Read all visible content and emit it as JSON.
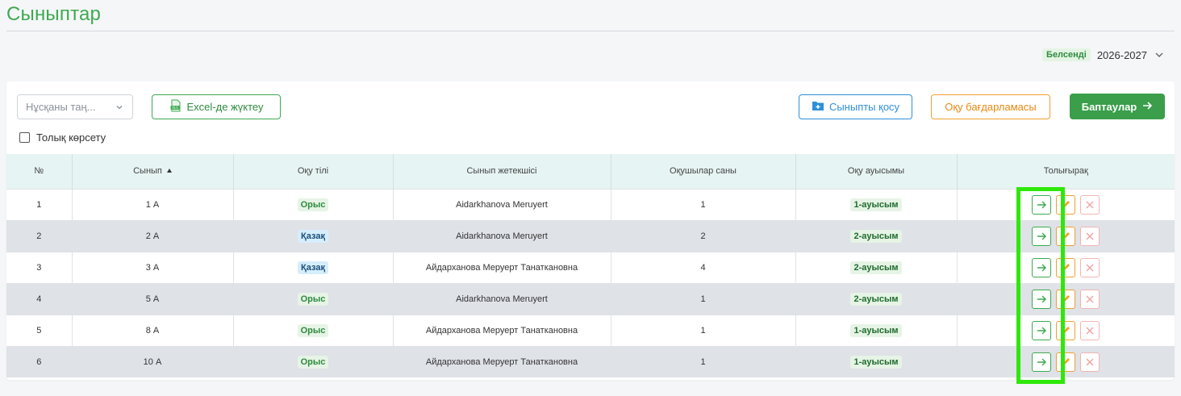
{
  "page": {
    "title": "Сыныптар"
  },
  "year_selector": {
    "badge": "Белсенді",
    "value": "2026-2027"
  },
  "toolbar": {
    "select_placeholder": "Нұсқаны таң...",
    "excel_label": "Excel-де жүктеу",
    "add_class_label": "Сыныпты қосу",
    "program_label": "Оқу бағдарламасы",
    "settings_label": "Баптаулар",
    "full_view_label": "Толық көрсету"
  },
  "table": {
    "headers": {
      "num": "№",
      "class": "Сынып",
      "language": "Оқу тілі",
      "teacher": "Сынып жетекшісі",
      "students": "Оқушылар саны",
      "shift": "Оқу ауысымы",
      "more": "Толығырақ"
    },
    "rows": [
      {
        "num": "1",
        "class": "1 А",
        "language": "Орыс",
        "lang_type": "ru",
        "teacher": "Aidarkhanova Meruyert",
        "students": "1",
        "shift": "1-ауысым"
      },
      {
        "num": "2",
        "class": "2 А",
        "language": "Қазақ",
        "lang_type": "kz",
        "teacher": "Aidarkhanova Meruyert",
        "students": "2",
        "shift": "2-ауысым"
      },
      {
        "num": "3",
        "class": "3 А",
        "language": "Қазақ",
        "lang_type": "kz",
        "teacher": "Айдарханова Меруерт Танаткановна",
        "students": "4",
        "shift": "2-ауысым"
      },
      {
        "num": "4",
        "class": "5 А",
        "language": "Орыс",
        "lang_type": "ru",
        "teacher": "Aidarkhanova Meruyert",
        "students": "1",
        "shift": "2-ауысым"
      },
      {
        "num": "5",
        "class": "8 А",
        "language": "Орыс",
        "lang_type": "ru",
        "teacher": "Айдарханова Меруерт Танаткановна",
        "students": "1",
        "shift": "1-ауысым"
      },
      {
        "num": "6",
        "class": "10 А",
        "language": "Орыс",
        "lang_type": "ru",
        "teacher": "Айдарханова Меруерт Танаткановна",
        "students": "1",
        "shift": "1-ауысым"
      }
    ]
  },
  "colors": {
    "brand_green": "#3daa4f",
    "highlight": "#2ee80a",
    "header_bg": "#e6f4f3"
  }
}
